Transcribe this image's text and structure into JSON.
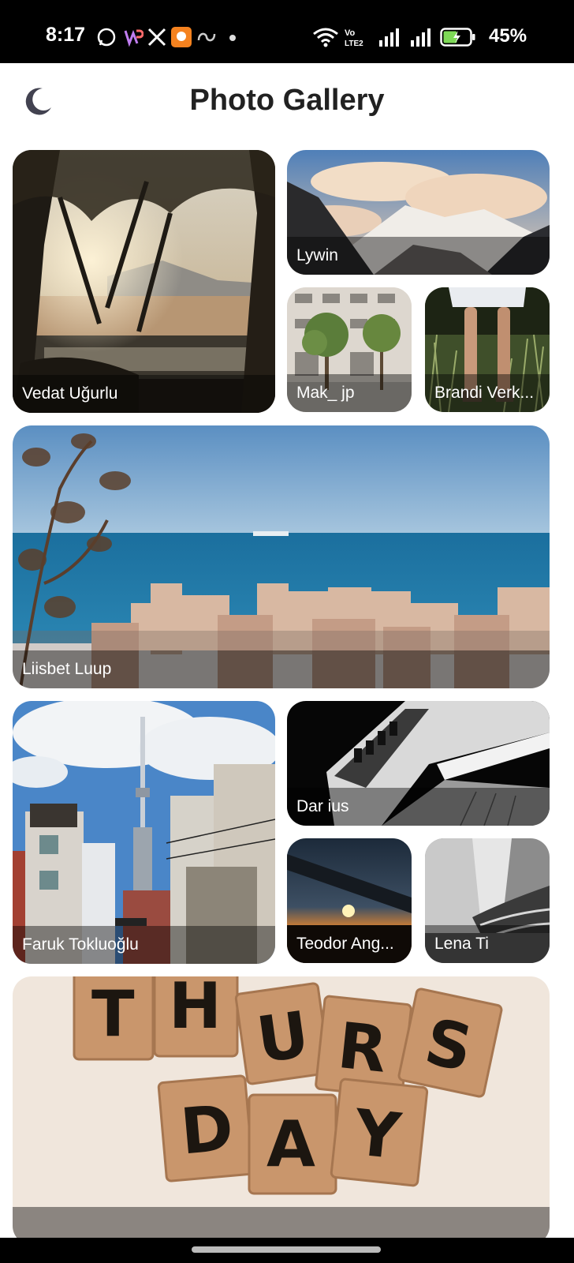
{
  "status_bar": {
    "time": "8:17",
    "battery_percent": "45%",
    "left_icons": [
      "whatsapp-icon",
      "wp-icon",
      "x-icon",
      "bell-app-icon",
      "loop-icon"
    ],
    "right_icons": [
      "wifi-icon",
      "volte-icon",
      "signal-icon",
      "signal-icon",
      "battery-charging-icon"
    ]
  },
  "app_bar": {
    "title": "Photo Gallery",
    "theme_icon": "moon-icon"
  },
  "gallery": {
    "photos": [
      {
        "author": "Vedat Uğurlu"
      },
      {
        "author": "Lywin"
      },
      {
        "author": "Mak_ jp"
      },
      {
        "author": "Brandi Verk..."
      },
      {
        "author": "Liisbet Luup"
      },
      {
        "author": "Faruk Tokluoğlu"
      },
      {
        "author": "Dar ius"
      },
      {
        "author": "Teodor Ang..."
      },
      {
        "author": "Lena Ti"
      },
      {
        "author": ""
      }
    ]
  },
  "colors": {
    "appbar_bg": "#ffffff",
    "title_text": "#212121",
    "status_bar_bg": "#000000",
    "battery_accent": "#7ED957"
  }
}
